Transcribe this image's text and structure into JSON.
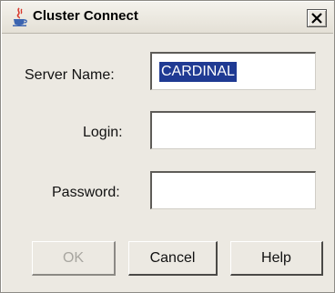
{
  "window": {
    "title": "Cluster Connect",
    "title_icon": "java-cup-icon",
    "close_icon": "close-x-icon"
  },
  "form": {
    "server_name": {
      "label": "Server Name:",
      "value": "CARDINAL"
    },
    "login": {
      "label": "Login:",
      "value": ""
    },
    "password": {
      "label": "Password:",
      "value": ""
    }
  },
  "buttons": {
    "ok": "OK",
    "cancel": "Cancel",
    "help": "Help"
  },
  "colors": {
    "dialog_bg": "#ece9e2",
    "selection": "#1f3a93",
    "disabled_text": "#a8a6a0"
  }
}
